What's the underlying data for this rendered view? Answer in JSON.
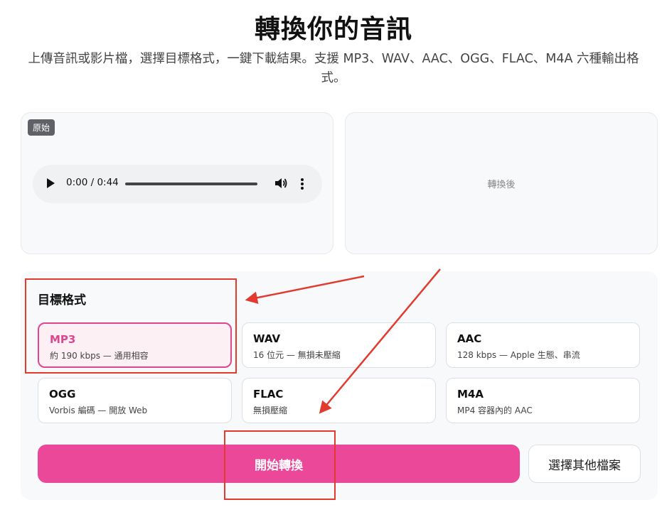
{
  "header": {
    "title": "轉換你的音訊",
    "subtitle": "上傳音訊或影片檔，選擇目標格式，一鍵下載結果。支援 MP3、WAV、AAC、OGG、FLAC、M4A 六種輸出格式。"
  },
  "original": {
    "badge": "原始",
    "player": {
      "time": "0:00 / 0:44",
      "icons": [
        "play-icon",
        "volume-icon",
        "more-options-icon"
      ]
    }
  },
  "converted": {
    "placeholder": "轉換後"
  },
  "formats": {
    "title": "目標格式",
    "selected": "MP3",
    "options": [
      {
        "name": "MP3",
        "desc": "約 190 kbps — 通用相容"
      },
      {
        "name": "WAV",
        "desc": "16 位元 — 無損未壓縮"
      },
      {
        "name": "AAC",
        "desc": "128 kbps — Apple 生態、串流"
      },
      {
        "name": "OGG",
        "desc": "Vorbis 編碼 — 開放 Web"
      },
      {
        "name": "FLAC",
        "desc": "無損壓縮"
      },
      {
        "name": "M4A",
        "desc": "MP4 容器內的 AAC"
      }
    ]
  },
  "actions": {
    "start_label": "開始轉換",
    "choose_label": "選擇其他檔案"
  },
  "colors": {
    "accent": "#ec4899",
    "selected_border": "#e0458f",
    "annotation": "#e23a2f"
  }
}
